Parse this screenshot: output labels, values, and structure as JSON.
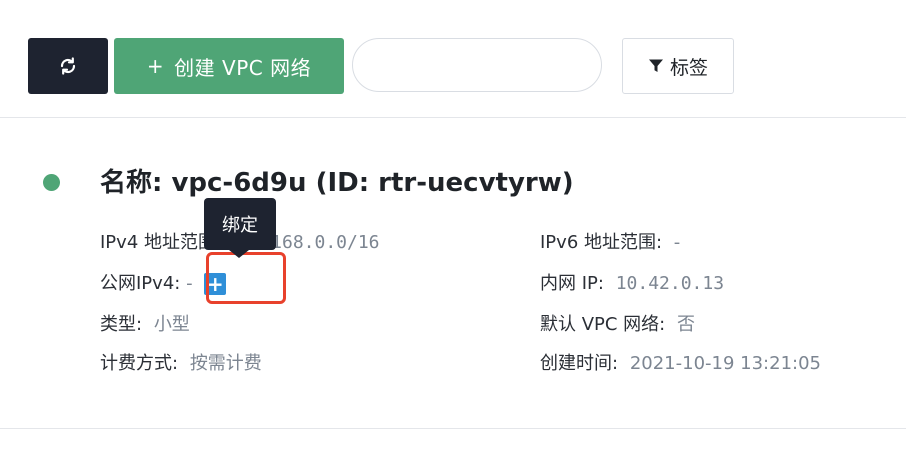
{
  "toolbar": {
    "refresh_icon": "refresh-icon",
    "create_plus": "+",
    "create_label": "创建 VPC 网络",
    "search_value": "",
    "search_placeholder": "",
    "tag_label": "标签",
    "tag_icon": "filter-icon"
  },
  "vpc": {
    "status_color": "#4fa576",
    "title": "名称: vpc-6d9u (ID: rtr-uecvtyrw)",
    "ipv4_label": "IPv4 地址范围:",
    "ipv4_value": "192.168.0.0/16",
    "public_ipv4_label": "公网IPv4:",
    "public_ipv4_value": "-",
    "bind_button": "+",
    "type_label": "类型:",
    "type_value": "小型",
    "billing_label": "计费方式:",
    "billing_value": "按需计费",
    "ipv6_label": "IPv6 地址范围:",
    "ipv6_value": "-",
    "internal_ip_label": "内网 IP:",
    "internal_ip_value": "10.42.0.13",
    "default_vpc_label": "默认 VPC 网络:",
    "default_vpc_value": "否",
    "created_label": "创建时间:",
    "created_value": "2021-10-19 13:21:05"
  },
  "tooltip": {
    "text": "绑定"
  },
  "colors": {
    "create_button": "#4fa576",
    "refresh_button": "#1e2330",
    "bind_button": "#2f8fd8",
    "highlight_border": "#e8412c"
  }
}
